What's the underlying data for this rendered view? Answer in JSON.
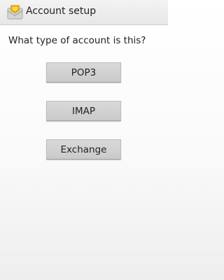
{
  "header": {
    "title": "Account setup",
    "icon": "envelope-icon"
  },
  "prompt": {
    "question": "What type of account is this?"
  },
  "options": [
    {
      "label": "POP3"
    },
    {
      "label": "IMAP"
    },
    {
      "label": "Exchange"
    }
  ],
  "colors": {
    "icon_body": "#d9a400",
    "icon_light": "#ffd23a",
    "button_bg": "#cecece"
  }
}
